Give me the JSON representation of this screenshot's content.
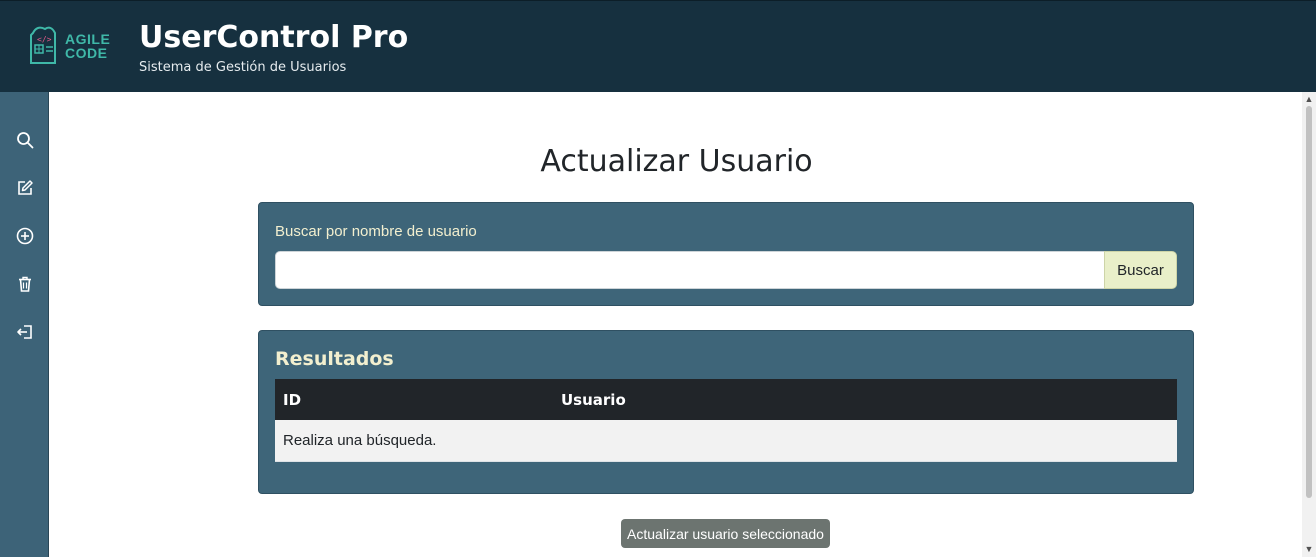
{
  "header": {
    "logo_line1": "AGILE",
    "logo_line2": "CODE",
    "title": "UserControl Pro",
    "subtitle": "Sistema de Gestión de Usuarios"
  },
  "sidebar": {
    "items": [
      {
        "icon": "search-icon"
      },
      {
        "icon": "edit-icon"
      },
      {
        "icon": "add-circle-icon"
      },
      {
        "icon": "trash-icon"
      },
      {
        "icon": "logout-icon"
      }
    ]
  },
  "main": {
    "page_title": "Actualizar Usuario",
    "search": {
      "label": "Buscar por nombre de usuario",
      "value": "",
      "button_label": "Buscar"
    },
    "results": {
      "title": "Resultados",
      "columns": [
        "ID",
        "Usuario"
      ],
      "empty_message": "Realiza una búsqueda."
    },
    "update_button_label": "Actualizar usuario seleccionado"
  },
  "colors": {
    "header_bg": "#16303f",
    "sidebar_bg": "#3d6378",
    "card_bg": "#3e6579",
    "accent_text": "#f2efcf",
    "search_button_bg": "#e9efc9",
    "table_header_bg": "#212529"
  }
}
